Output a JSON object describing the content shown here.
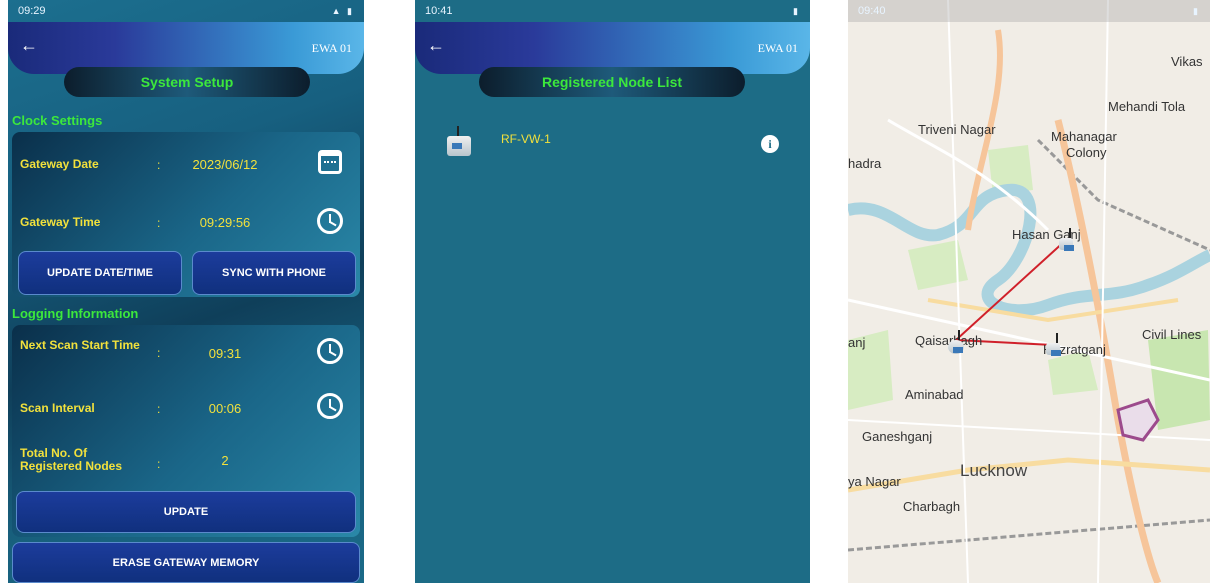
{
  "screen1": {
    "status_time": "09:29",
    "device_name": "EWA 01",
    "title": "System Setup",
    "clock_section": "Clock Settings",
    "gateway_date_label": "Gateway Date",
    "gateway_date_value": "2023/06/12",
    "gateway_time_label": "Gateway Time",
    "gateway_time_value": "09:29:56",
    "update_datetime_button": "UPDATE DATE/TIME",
    "sync_phone_button": "SYNC WITH PHONE",
    "logging_section": "Logging Information",
    "next_scan_label": "Next Scan Start Time",
    "next_scan_value": "09:31",
    "scan_interval_label": "Scan Interval",
    "scan_interval_value": "00:06",
    "total_nodes_label": "Total No. Of Registered Nodes",
    "total_nodes_value": "2",
    "update_button": "UPDATE",
    "erase_button": "ERASE GATEWAY MEMORY",
    "colon": ":"
  },
  "screen2": {
    "status_time": "10:41",
    "device_name": "EWA 01",
    "title": "Registered Node List",
    "nodes": [
      {
        "name": "RF-VW-1"
      }
    ]
  },
  "screen3": {
    "status_time": "09:40",
    "labels": {
      "vikas": "Vikas",
      "mehandi_tola": "Mehandi Tola",
      "triveni_nagar": "Triveni Nagar",
      "mahanagar": "Mahanagar",
      "colony": "Colony",
      "hadra": "hadra",
      "hasan_ganj": "Hasan Ganj",
      "qaisarbagh": "Qaisarbagh",
      "hazratganj": "Hazratganj",
      "civil_lines": "Civil Lines",
      "anj": "anj",
      "aminabad": "Aminabad",
      "ganeshganj": "Ganeshganj",
      "lucknow": "Lucknow",
      "ya_nagar": "ya Nagar",
      "charbagh": "Charbagh"
    },
    "colors": {
      "link_line": "#d0202a",
      "river": "#aad3df",
      "park": "#c8e6b0",
      "road_major": "#f6c59a"
    }
  }
}
